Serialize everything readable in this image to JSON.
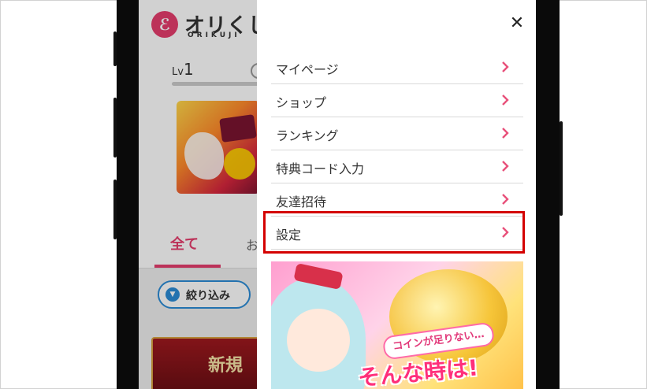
{
  "app": {
    "logo_mark": "ℰ",
    "logo_text": "オリくじ",
    "logo_sub": "ORIKUJI",
    "level_prefix": "Lv",
    "level_value": "1",
    "tabs": [
      "全て",
      "お"
    ],
    "filter_label": "絞り込み",
    "red_banner_text": "新規"
  },
  "drawer": {
    "close_symbol": "✕",
    "menu_items": [
      {
        "label": "マイページ"
      },
      {
        "label": "ショップ"
      },
      {
        "label": "ランキング"
      },
      {
        "label": "特典コード入力"
      },
      {
        "label": "友達招待"
      },
      {
        "label": "設定"
      }
    ],
    "promo": {
      "subtitle": "コインが足りない…",
      "headline": "そんな時は!"
    }
  },
  "colors": {
    "accent": "#e63e6d",
    "chevron": "#e8507a",
    "highlight": "#d40000",
    "filter_blue": "#2b8cd6"
  },
  "icons": {
    "close": "close-icon",
    "chevron": "chevron-right-icon",
    "filter": "filter-icon"
  }
}
